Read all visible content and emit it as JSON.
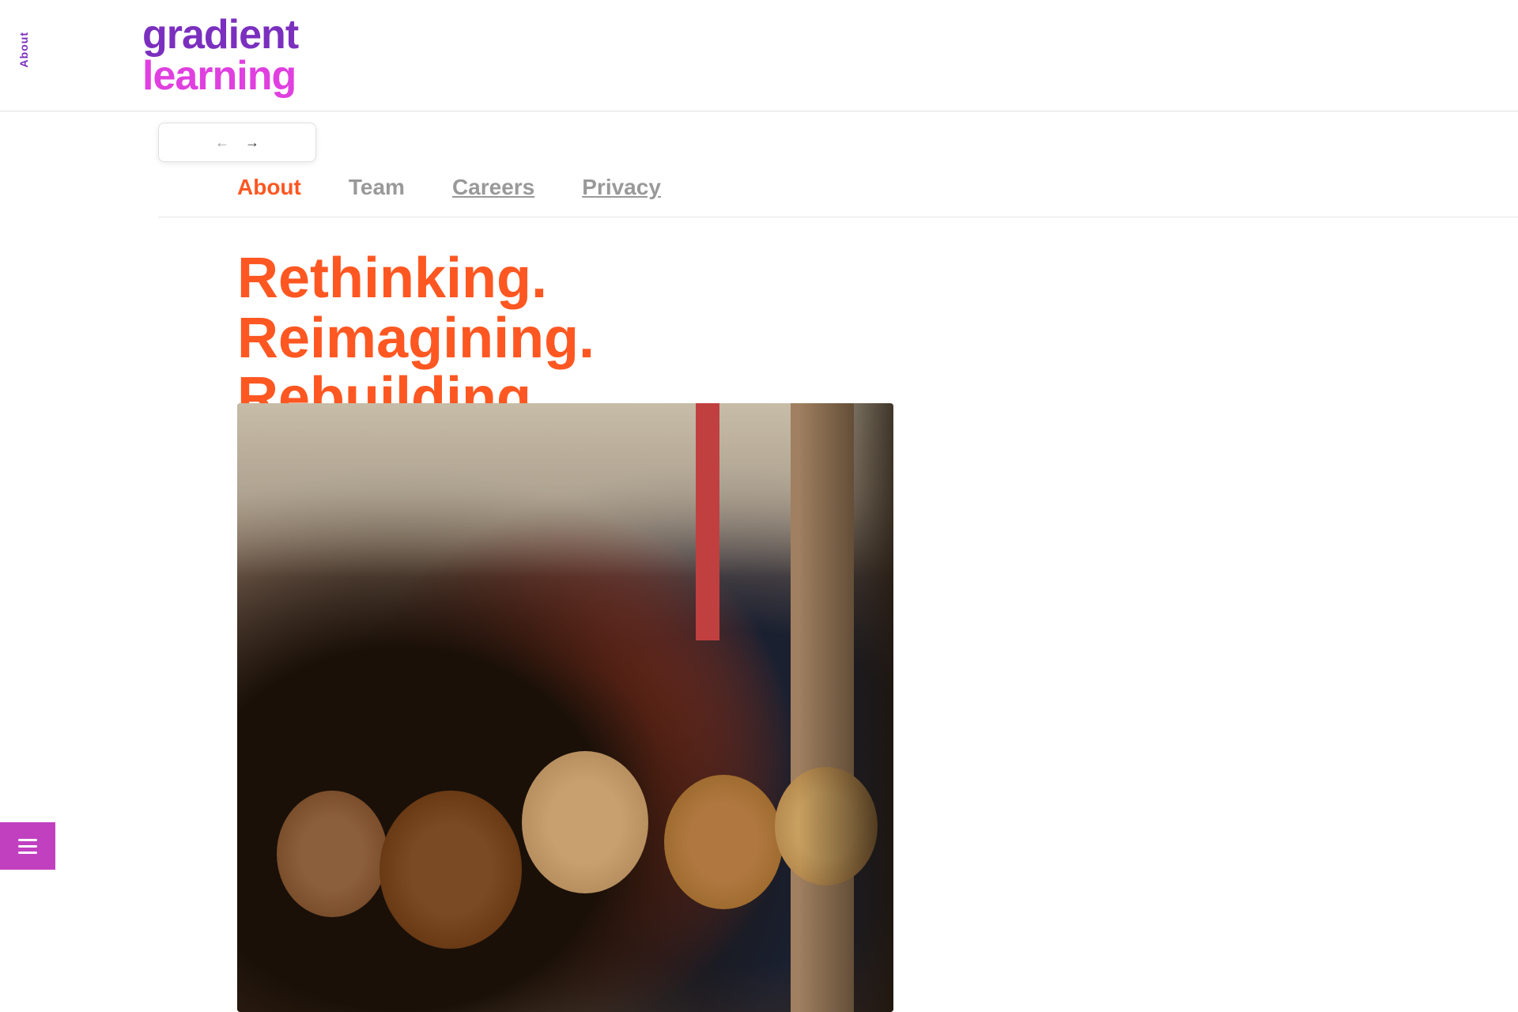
{
  "logo": {
    "gradient_text": "gradient",
    "learning_text": "learning"
  },
  "sidebar": {
    "about_label": "About"
  },
  "browser_nav": {
    "back_arrow": "←",
    "forward_arrow": "→"
  },
  "sub_nav": {
    "items": [
      {
        "label": "About",
        "active": true,
        "underlined": false
      },
      {
        "label": "Team",
        "active": false,
        "underlined": false
      },
      {
        "label": "Careers",
        "active": false,
        "underlined": true
      },
      {
        "label": "Privacy",
        "active": false,
        "underlined": true
      }
    ]
  },
  "hero": {
    "headline_line1": "Rethinking.",
    "headline_line2": "Reimagining.",
    "headline_line3": "Rebuilding."
  },
  "menu": {
    "label": "menu"
  },
  "colors": {
    "brand_purple": "#7b2fbe",
    "brand_pink": "#e040e0",
    "accent_orange": "#ff5722",
    "menu_purple": "#c040c0",
    "nav_gray": "#999999",
    "underline_gray": "#888888"
  }
}
